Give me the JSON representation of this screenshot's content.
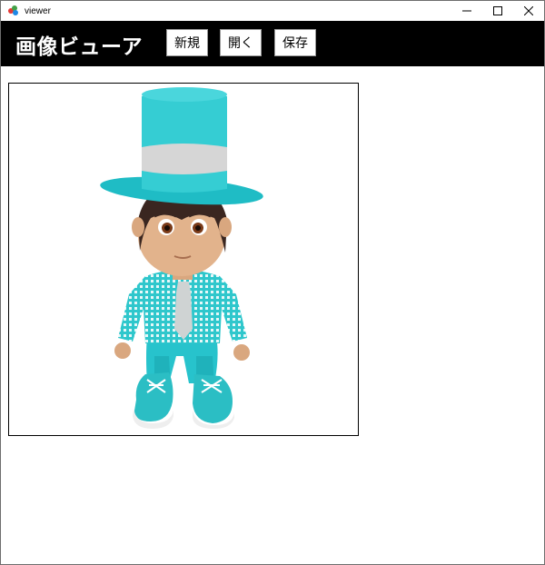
{
  "window": {
    "title": "viewer",
    "controls": [
      "minimize-icon",
      "maximize-icon",
      "close-icon"
    ]
  },
  "toolbar": {
    "app_title": "画像ビューア",
    "new_label": "新規",
    "open_label": "開く",
    "save_label": "保存"
  },
  "viewer": {
    "image_description": "3D cartoon boy avatar in turquoise top hat, checked shirt, tie and sneakers"
  },
  "colors": {
    "toolbar_bg": "#000000",
    "accent": "#2ec8cf"
  }
}
